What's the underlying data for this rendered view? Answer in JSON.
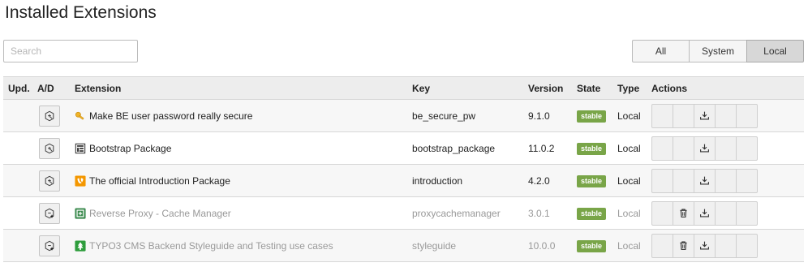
{
  "page": {
    "title": "Installed Extensions"
  },
  "search": {
    "placeholder": "Search",
    "value": ""
  },
  "filters": [
    {
      "label": "All",
      "active": false
    },
    {
      "label": "System",
      "active": false
    },
    {
      "label": "Local",
      "active": true
    }
  ],
  "table": {
    "headers": {
      "upd": "Upd.",
      "ad": "A/D",
      "extension": "Extension",
      "key": "Key",
      "version": "Version",
      "state": "State",
      "type": "Type",
      "actions": "Actions"
    },
    "rows": [
      {
        "name": "Make BE user password really secure",
        "key": "be_secure_pw",
        "version": "9.1.0",
        "state": "stable",
        "type": "Local",
        "icon": "key-icon",
        "active": true
      },
      {
        "name": "Bootstrap Package",
        "key": "bootstrap_package",
        "version": "11.0.2",
        "state": "stable",
        "type": "Local",
        "icon": "bootstrap-icon",
        "active": true
      },
      {
        "name": "The official Introduction Package",
        "key": "introduction",
        "version": "4.2.0",
        "state": "stable",
        "type": "Local",
        "icon": "typo3-icon",
        "active": true
      },
      {
        "name": "Reverse Proxy - Cache Manager",
        "key": "proxycachemanager",
        "version": "3.0.1",
        "state": "stable",
        "type": "Local",
        "icon": "proxy-icon",
        "active": false
      },
      {
        "name": "TYPO3 CMS Backend Styleguide and Testing use cases",
        "key": "styleguide",
        "version": "10.0.0",
        "state": "stable",
        "type": "Local",
        "icon": "styleguide-icon",
        "active": false
      }
    ]
  },
  "colors": {
    "stable_badge": "#79a548",
    "filter_active": "#d7d7d7",
    "header_bg": "#ededed"
  }
}
